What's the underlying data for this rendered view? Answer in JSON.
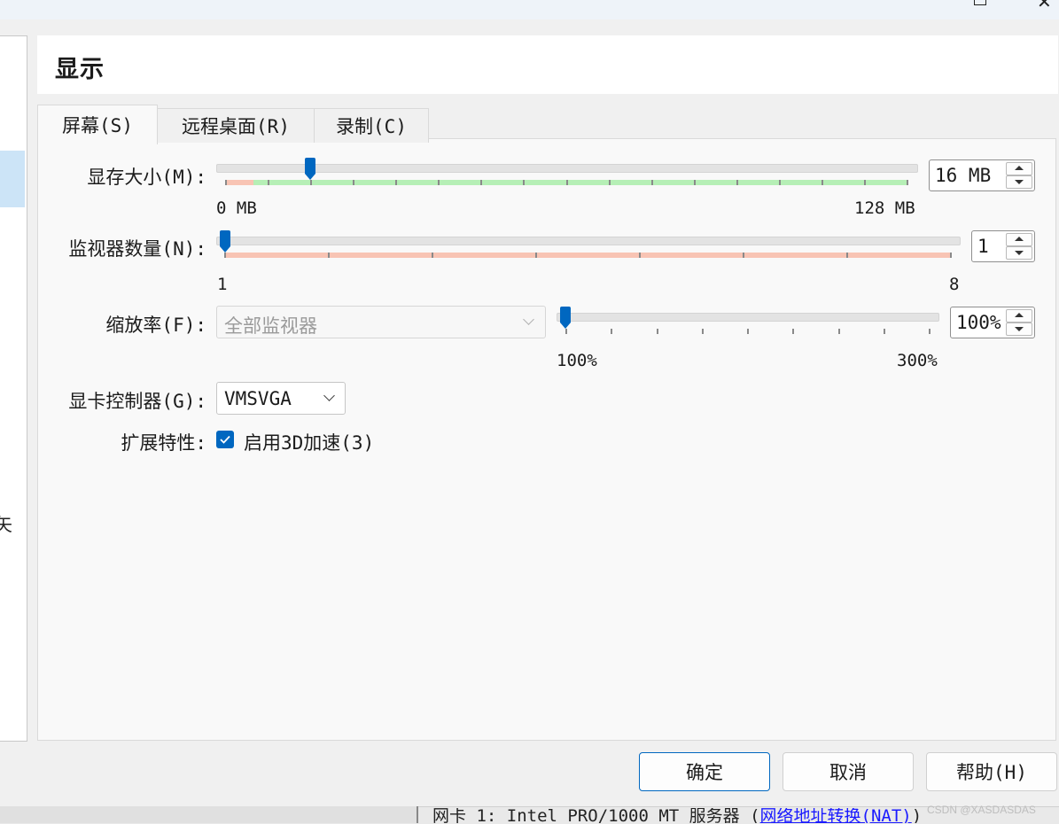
{
  "window": {
    "title": ""
  },
  "left_panel": {
    "partial_char": "矢"
  },
  "header": {
    "title": "显示"
  },
  "tabs": [
    {
      "label": "屏幕(S)",
      "active": true
    },
    {
      "label": "远程桌面(R)",
      "active": false
    },
    {
      "label": "录制(C)",
      "active": false
    }
  ],
  "video_memory": {
    "label": "显存大小(M):",
    "value": 16,
    "min": 0,
    "max": 128,
    "spin_text": "16 MB",
    "min_label": "0 MB",
    "max_label": "128 MB"
  },
  "monitor_count": {
    "label": "监视器数量(N):",
    "value": 1,
    "min": 1,
    "max": 8,
    "spin_text": "1",
    "min_label": "1",
    "max_label": "8"
  },
  "scale_factor": {
    "label": "缩放率(F):",
    "monitor_select": "全部监视器",
    "value": 100,
    "min": 100,
    "max": 300,
    "spin_text": "100%",
    "min_label": "100%",
    "max_label": "300%"
  },
  "graphics_controller": {
    "label": "显卡控制器(G):",
    "value": "VMSVGA"
  },
  "extended_features": {
    "label": "扩展特性:",
    "accel3d_label": "启用3D加速(3)",
    "accel3d_checked": true
  },
  "buttons": {
    "ok": "确定",
    "cancel": "取消",
    "help": "帮助(H)"
  },
  "status_bar": {
    "prefix": "网卡 1:  Intel PRO/1000 MT 服务器 (",
    "link": "网络地址转换(NAT)",
    "suffix": ")"
  },
  "watermark": "CSDN @XASDASDAS",
  "colors": {
    "accent": "#0067c0",
    "green_band": "#b6efb6",
    "red_band": "#f8c4b4",
    "selection": "#cce4f7"
  }
}
